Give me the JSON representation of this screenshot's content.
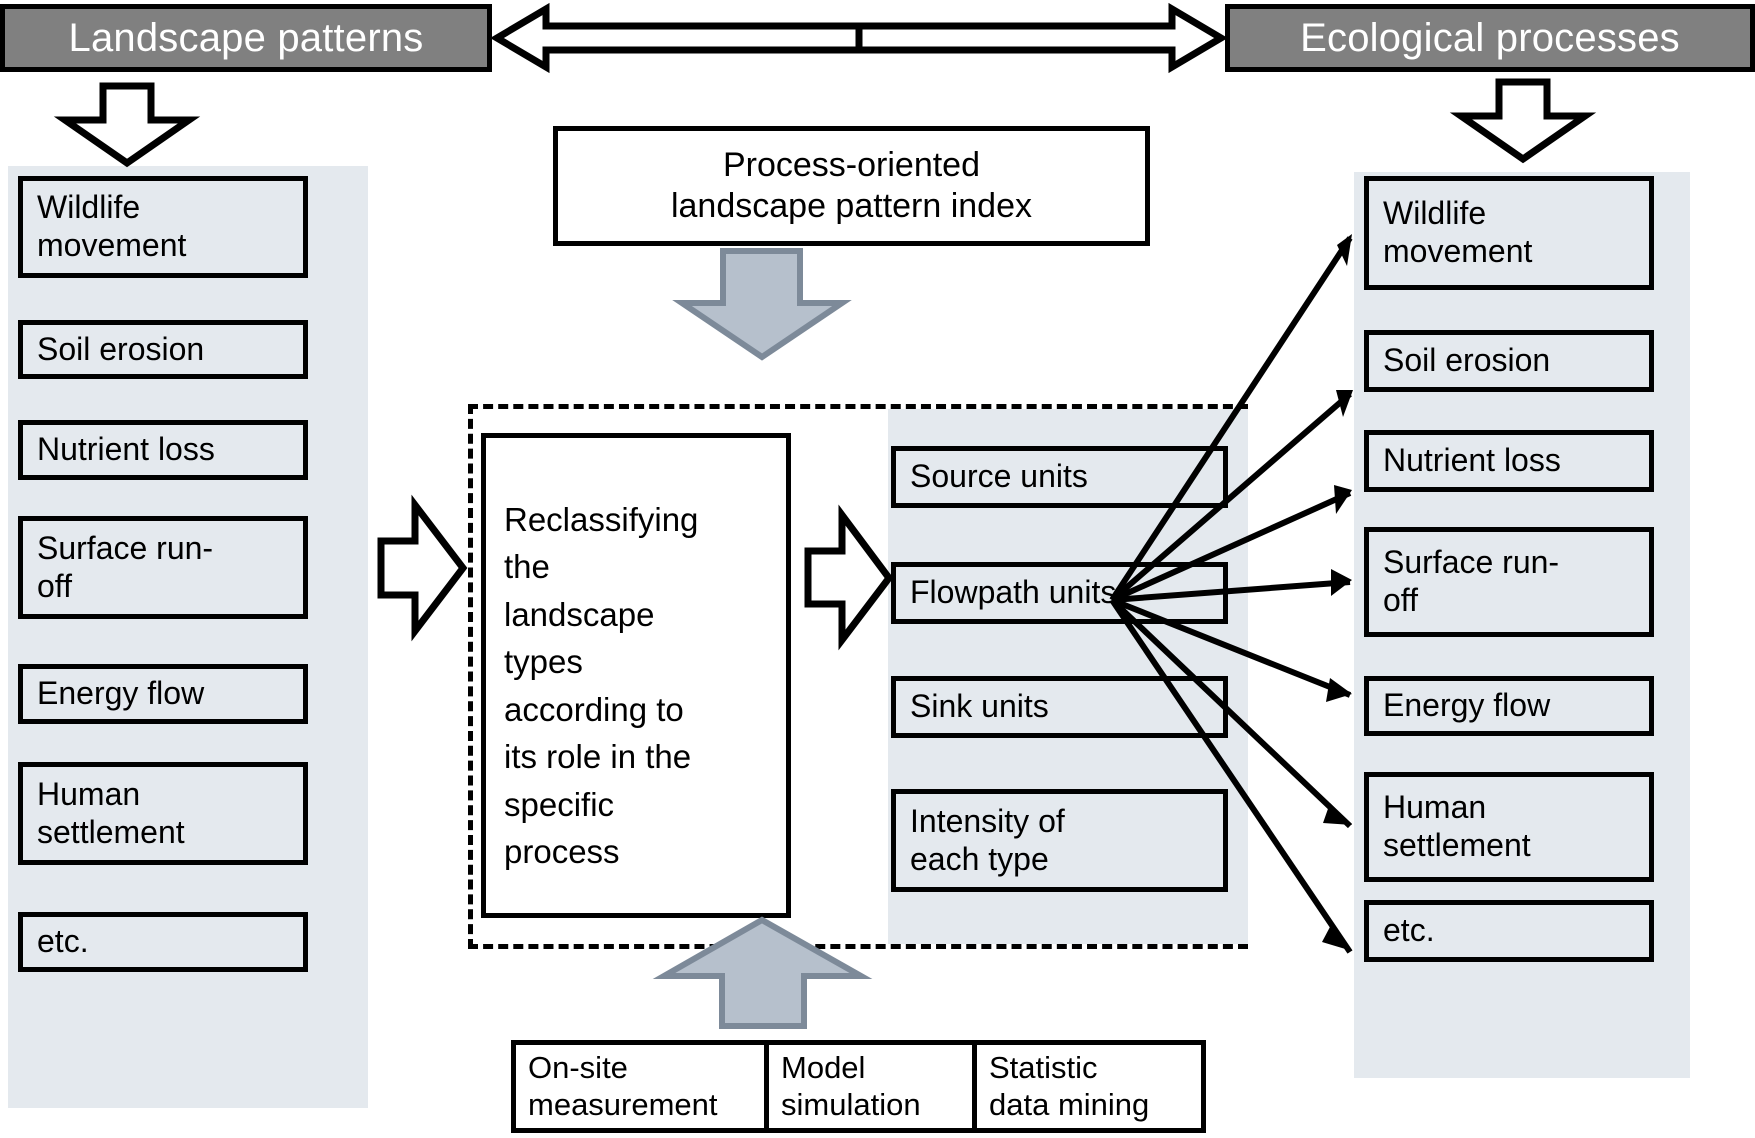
{
  "header": {
    "left_title": "Landscape patterns",
    "right_title": "Ecological processes"
  },
  "colors": {
    "banner_fill": "#808080",
    "banner_text": "#ffffff",
    "box_fill": "#e4e9ee",
    "panel_fill": "#e4e9ee",
    "outline": "#000000",
    "block_arrow_fill": "#b6c0cc",
    "block_arrow_stroke": "#7d8a99"
  },
  "left_column": {
    "items": [
      {
        "label": "Wildlife\nmovement"
      },
      {
        "label": "Soil erosion"
      },
      {
        "label": "Nutrient loss"
      },
      {
        "label": "Surface run-\noff"
      },
      {
        "label": "Energy flow"
      },
      {
        "label": "Human\nsettlement"
      },
      {
        "label": "etc."
      }
    ]
  },
  "right_column": {
    "items": [
      {
        "label": "Wildlife\nmovement"
      },
      {
        "label": "Soil erosion"
      },
      {
        "label": "Nutrient loss"
      },
      {
        "label": "Surface run-\noff"
      },
      {
        "label": "Energy flow"
      },
      {
        "label": "Human\nsettlement"
      },
      {
        "label": "etc."
      }
    ]
  },
  "center": {
    "process_index": "Process-oriented\nlandscape pattern index",
    "reclassify": "Reclassifying\nthe\nlandscape\ntypes\naccording to\nits role in the\nspecific\nprocess",
    "unit_items": [
      {
        "label": "Source units"
      },
      {
        "label": "Flowpath units"
      },
      {
        "label": "Sink units"
      },
      {
        "label": "Intensity of\neach type"
      }
    ]
  },
  "methods": {
    "items": [
      {
        "label": "On-site\nmeasurement"
      },
      {
        "label": "Model\nsimulation"
      },
      {
        "label": "Statistic\ndata mining"
      }
    ]
  }
}
